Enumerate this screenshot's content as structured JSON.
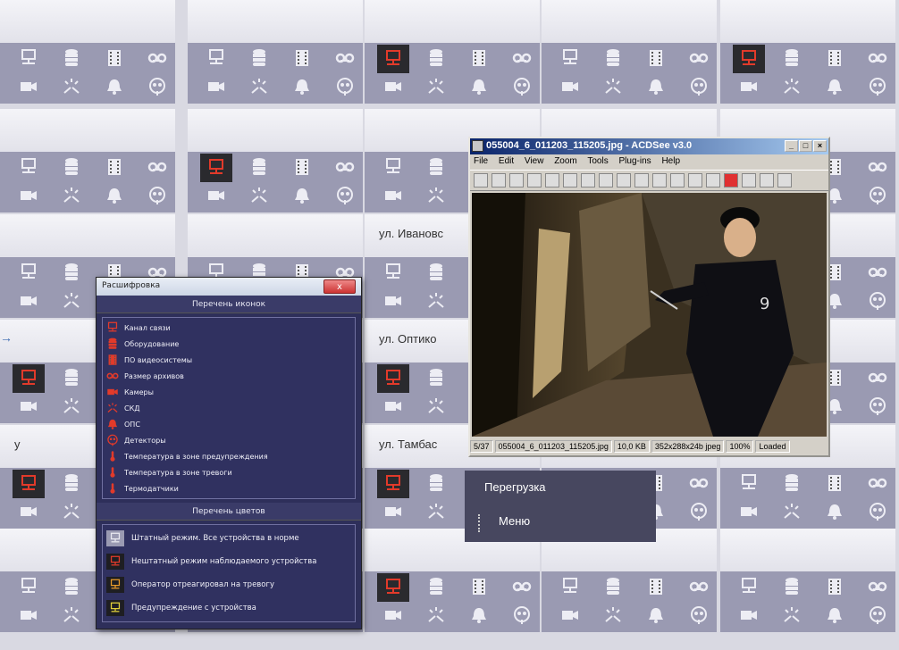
{
  "arrow": "→",
  "tiles": [
    {
      "label": "",
      "sel": "",
      "alarm": -1
    },
    {
      "label": "",
      "sel": "",
      "alarm": -1
    },
    {
      "label": "",
      "sel": "green",
      "alarm": 0
    },
    {
      "label": "",
      "sel": "",
      "alarm": -1
    },
    {
      "label": "",
      "sel": "",
      "alarm": 0
    },
    {
      "label": "",
      "sel": "",
      "alarm": -1
    },
    {
      "label": "",
      "sel": "red",
      "alarm": 0
    },
    {
      "label": "",
      "sel": "",
      "alarm": -1
    },
    {
      "label": "",
      "sel": "",
      "alarm": -1
    },
    {
      "label": "",
      "sel": "",
      "alarm": -1
    },
    {
      "label": "",
      "sel": "",
      "alarm": -1
    },
    {
      "label": "",
      "sel": "",
      "alarm": -1
    },
    {
      "label": "ул. Ивановс",
      "sel": "",
      "alarm": -1
    },
    {
      "label": "",
      "sel": "",
      "alarm": -1
    },
    {
      "label": "",
      "sel": "",
      "alarm": -1
    },
    {
      "label": "",
      "sel": "",
      "alarm": 0
    },
    {
      "label": "",
      "sel": "",
      "alarm": -1
    },
    {
      "label": "ул. Оптико",
      "sel": "",
      "alarm": 0
    },
    {
      "label": "",
      "sel": "",
      "alarm": -1
    },
    {
      "label": "",
      "sel": "",
      "alarm": -1
    },
    {
      "label": "у",
      "sel": "",
      "alarm": 0
    },
    {
      "label": "",
      "sel": "",
      "alarm": -1
    },
    {
      "label": "ул. Тамбас",
      "sel": "",
      "alarm": 0
    },
    {
      "label": "",
      "sel": "",
      "alarm": -1
    },
    {
      "label": "",
      "sel": "",
      "alarm": -1
    },
    {
      "label": "",
      "sel": "",
      "alarm": -1
    },
    {
      "label": "",
      "sel": "",
      "alarm": -1
    },
    {
      "label": "",
      "sel": "",
      "alarm": 0
    },
    {
      "label": "",
      "sel": "",
      "alarm": -1
    },
    {
      "label": "",
      "sel": "",
      "alarm": -1
    }
  ],
  "legend": {
    "title": "Расшифровка",
    "close": "x",
    "icons_header": "Перечень иконок",
    "icons": [
      {
        "icon": "monitor-icon",
        "label": "Канал связи"
      },
      {
        "icon": "database-icon",
        "label": "Оборудование"
      },
      {
        "icon": "film-icon",
        "label": "ПО видеосистемы"
      },
      {
        "icon": "tape-icon",
        "label": "Размер архивов"
      },
      {
        "icon": "camera-icon",
        "label": "Камеры"
      },
      {
        "icon": "access-icon",
        "label": "СКД"
      },
      {
        "icon": "bell-icon",
        "label": "ОПС"
      },
      {
        "icon": "detector-icon",
        "label": "Детекторы"
      },
      {
        "icon": "thermometer-icon",
        "label": "Температура в зоне предупреждения"
      },
      {
        "icon": "thermometer-icon",
        "label": "Температура в зоне тревоги"
      },
      {
        "icon": "thermometer-icon",
        "label": "Термодатчики"
      }
    ],
    "colors_header": "Перечень цветов",
    "colors": [
      {
        "bg": "#9a9ab2",
        "fg": "#e8e8f0",
        "label": "Штатный режим. Все устройства в норме"
      },
      {
        "bg": "#1e1e22",
        "fg": "#e23a2a",
        "label": "Нештатный режим наблюдаемого устройства"
      },
      {
        "bg": "#1e1e22",
        "fg": "#e89a2a",
        "label": "Оператор отреагировал на тревогу"
      },
      {
        "bg": "#1e1e22",
        "fg": "#e0d03a",
        "label": "Предупреждение с устройства"
      }
    ]
  },
  "context_menu": {
    "items": [
      "Перегрузка",
      "Меню"
    ]
  },
  "acdsee": {
    "title": "055004_6_011203_115205.jpg - ACDSee v3.0",
    "menu": [
      "File",
      "Edit",
      "View",
      "Zoom",
      "Tools",
      "Plug-ins",
      "Help"
    ],
    "status": [
      "5/37",
      "055004_6_011203_115205.jpg",
      "10,0 KB",
      "352x288x24b jpeg",
      "100%",
      "Loaded"
    ]
  },
  "colors": {
    "tile_body": "#9a9ab2",
    "alarm_red": "#e23a2a",
    "sel_green": "#8bc53a",
    "sel_red": "#d8584a"
  }
}
